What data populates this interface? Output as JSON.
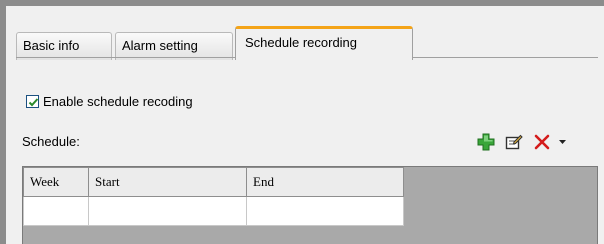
{
  "tabs": [
    {
      "label": "Basic info"
    },
    {
      "label": "Alarm setting"
    },
    {
      "label": "Schedule recording",
      "active": true
    }
  ],
  "enable_checkbox": {
    "label": "Enable schedule recoding",
    "checked": true
  },
  "schedule_label": "Schedule:",
  "toolbar": {
    "icons": [
      "add-icon",
      "edit-icon",
      "delete-icon",
      "dropdown-arrow-icon"
    ],
    "colors": {
      "add": "#2e9b2e",
      "delete": "#d41b1b"
    }
  },
  "table": {
    "columns": [
      "Week",
      "Start",
      "End"
    ],
    "rows": [
      [
        "",
        "",
        ""
      ]
    ]
  },
  "colors": {
    "active_tab_accent": "#f4a418",
    "grid_empty_area": "#a9a9a9"
  }
}
